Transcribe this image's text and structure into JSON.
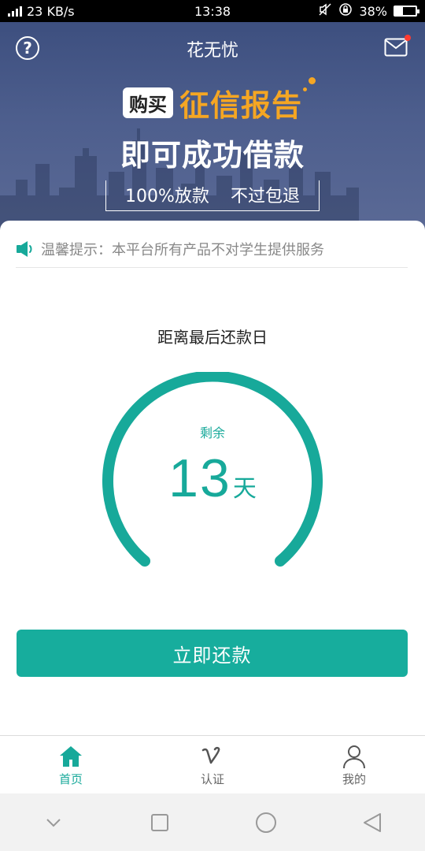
{
  "status_bar": {
    "network_type": "4G",
    "speed": "23 KB/s",
    "time": "13:38",
    "battery_percent": "38%",
    "battery_level": 0.38
  },
  "header": {
    "title": "花无忧",
    "help_icon": "help-icon",
    "mail_icon": "mail-icon"
  },
  "promo": {
    "buy_tag": "购买",
    "highlight": "征信报告",
    "headline": "即可成功借款",
    "feature_1": "100%放款",
    "feature_2": "不过包退"
  },
  "notice": {
    "text": "温馨提示：本平台所有产品不对学生提供服务"
  },
  "countdown": {
    "title": "距离最后还款日",
    "label": "剩余",
    "value": "13",
    "unit": "天"
  },
  "repay_button": {
    "label": "立即还款"
  },
  "tabs": [
    {
      "label": "首页",
      "icon": "home-icon",
      "active": true
    },
    {
      "label": "认证",
      "icon": "verify-icon",
      "active": false
    },
    {
      "label": "我的",
      "icon": "person-icon",
      "active": false
    }
  ],
  "colors": {
    "accent": "#17ad9d",
    "promo_highlight": "#f5a623",
    "banner": "#4d5e8d"
  }
}
